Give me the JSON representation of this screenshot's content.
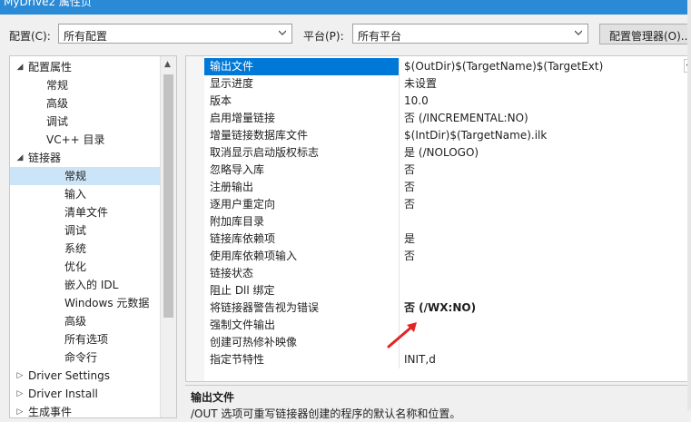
{
  "window": {
    "title": "MyDrive2 属性页"
  },
  "config_bar": {
    "config_label": "配置(C):",
    "config_value": "所有配置",
    "platform_label": "平台(P):",
    "platform_value": "所有平台",
    "config_manager_label": "配置管理器(O)..."
  },
  "tree": {
    "items": [
      {
        "label": "配置属性",
        "toggle": "◢"
      },
      {
        "label": "常规"
      },
      {
        "label": "高级"
      },
      {
        "label": "调试"
      },
      {
        "label": "VC++ 目录"
      },
      {
        "label": "链接器",
        "toggle": "◢"
      },
      {
        "label": "常规",
        "selected": true
      },
      {
        "label": "输入"
      },
      {
        "label": "清单文件"
      },
      {
        "label": "调试"
      },
      {
        "label": "系统"
      },
      {
        "label": "优化"
      },
      {
        "label": "嵌入的 IDL"
      },
      {
        "label": "Windows 元数据"
      },
      {
        "label": "高级"
      },
      {
        "label": "所有选项"
      },
      {
        "label": "命令行"
      },
      {
        "label": "Driver Settings",
        "toggle": "▷"
      },
      {
        "label": "Driver Install",
        "toggle": "▷"
      },
      {
        "label": "生成事件",
        "toggle": "▷"
      }
    ]
  },
  "properties": {
    "rows": [
      {
        "name": "输出文件",
        "value": "$(OutDir)$(TargetName)$(TargetExt)",
        "selected": true
      },
      {
        "name": "显示进度",
        "value": "未设置"
      },
      {
        "name": "版本",
        "value": "10.0"
      },
      {
        "name": "启用增量链接",
        "value": "否 (/INCREMENTAL:NO)"
      },
      {
        "name": "增量链接数据库文件",
        "value": "$(IntDir)$(TargetName).ilk"
      },
      {
        "name": "取消显示启动版权标志",
        "value": "是 (/NOLOGO)"
      },
      {
        "name": "忽略导入库",
        "value": "否"
      },
      {
        "name": "注册输出",
        "value": "否"
      },
      {
        "name": "逐用户重定向",
        "value": "否"
      },
      {
        "name": "附加库目录",
        "value": ""
      },
      {
        "name": "链接库依赖项",
        "value": "是"
      },
      {
        "name": "使用库依赖项输入",
        "value": "否"
      },
      {
        "name": "链接状态",
        "value": ""
      },
      {
        "name": "阻止 Dll 绑定",
        "value": ""
      },
      {
        "name": "将链接器警告视为错误",
        "value": "否 (/WX:NO)",
        "bold": true
      },
      {
        "name": "强制文件输出",
        "value": ""
      },
      {
        "name": "创建可热修补映像",
        "value": ""
      },
      {
        "name": "指定节特性",
        "value": "INIT,d"
      }
    ]
  },
  "description": {
    "title": "输出文件",
    "text": "/OUT 选项可重写链接器创建的程序的默认名称和位置。"
  },
  "colors": {
    "selection": "#0078d7",
    "tree_selection": "#cce4f7",
    "annotation_arrow": "#e32424"
  }
}
